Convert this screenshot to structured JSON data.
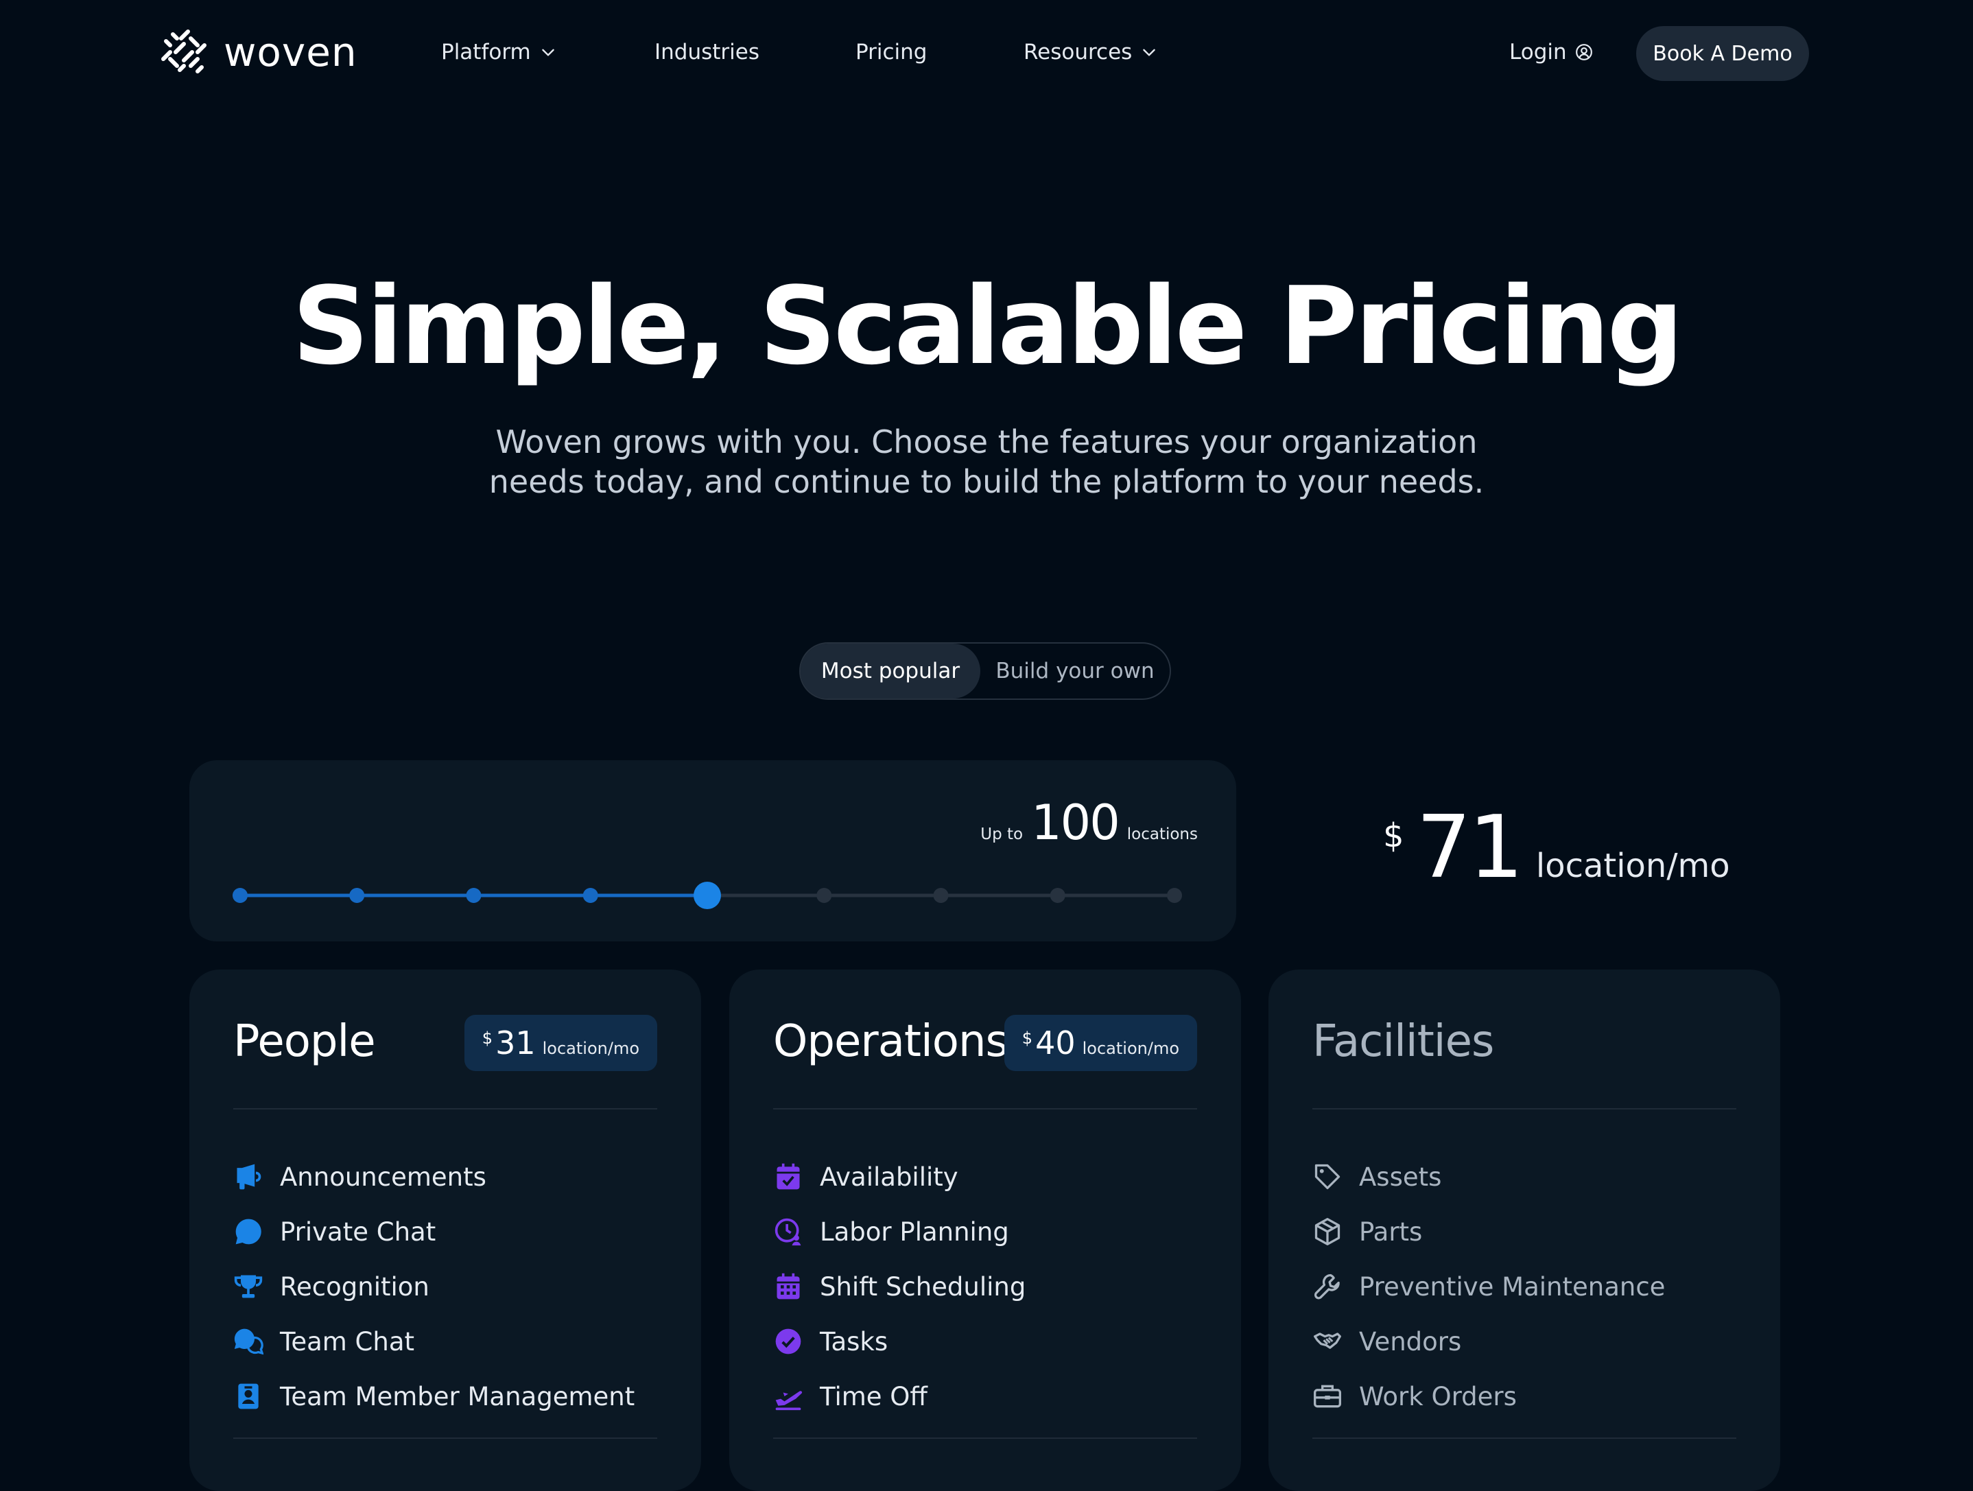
{
  "brand": {
    "name": "woven"
  },
  "nav": {
    "items": [
      {
        "label": "Platform",
        "has_dropdown": true
      },
      {
        "label": "Industries",
        "has_dropdown": false
      },
      {
        "label": "Pricing",
        "has_dropdown": false
      },
      {
        "label": "Resources",
        "has_dropdown": true
      }
    ],
    "login_label": "Login",
    "demo_label": "Book A Demo"
  },
  "hero": {
    "title": "Simple, Scalable Pricing",
    "subtitle_line1": "Woven grows with you. Choose the features your organization",
    "subtitle_line2": "needs today, and continue to build the platform to your needs."
  },
  "plan_toggle": {
    "options": [
      "Most popular",
      "Build your own"
    ],
    "selected": "Most popular"
  },
  "locations": {
    "prefix": "Up to",
    "count": "100",
    "suffix": "locations",
    "slider": {
      "steps": 9,
      "selected_index": 4
    }
  },
  "total": {
    "currency": "$",
    "amount": "71",
    "unit": "location/mo"
  },
  "cards": {
    "people": {
      "title": "People",
      "price": {
        "currency": "$",
        "amount": "31",
        "unit": "location/mo"
      },
      "features": [
        "Announcements",
        "Private Chat",
        "Recognition",
        "Team Chat",
        "Team Member Management"
      ],
      "icons": [
        "megaphone-icon",
        "chat-bubble-icon",
        "trophy-icon",
        "chat-bubbles-icon",
        "id-badge-icon"
      ]
    },
    "operations": {
      "title": "Operations",
      "price": {
        "currency": "$",
        "amount": "40",
        "unit": "location/mo"
      },
      "features": [
        "Availability",
        "Labor Planning",
        "Shift Scheduling",
        "Tasks",
        "Time Off"
      ],
      "icons": [
        "calendar-check-icon",
        "clock-person-icon",
        "calendar-grid-icon",
        "check-circle-icon",
        "airplane-icon"
      ]
    },
    "facilities": {
      "title": "Facilities",
      "features": [
        "Assets",
        "Parts",
        "Preventive Maintenance",
        "Vendors",
        "Work Orders"
      ],
      "icons": [
        "tag-icon",
        "box-icon",
        "wrench-icon",
        "handshake-icon",
        "toolbox-icon"
      ]
    }
  },
  "colors": {
    "background": "#020c17",
    "card": "#0b1824",
    "accent_blue": "#1b84e6",
    "accent_purple": "#7c3aed",
    "muted": "#a9b4c0"
  }
}
